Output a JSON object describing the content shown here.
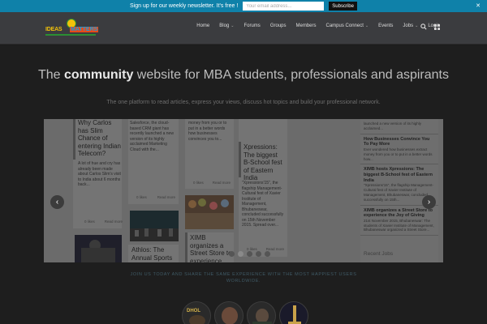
{
  "newsletter": {
    "message": "Sign up for our weekly newsletter. It's free !",
    "email_placeholder": "Your email address...",
    "subscribe_label": "Subscribe",
    "close_glyph": "✕"
  },
  "logo": {
    "word1": "IDEAS",
    "word2": "MATTERS"
  },
  "nav": {
    "items": [
      {
        "label": "Home",
        "dropdown": false
      },
      {
        "label": "Blog",
        "dropdown": true
      },
      {
        "label": "Forums",
        "dropdown": false
      },
      {
        "label": "Groups",
        "dropdown": false
      },
      {
        "label": "Members",
        "dropdown": false
      },
      {
        "label": "Campus Connect",
        "dropdown": true
      },
      {
        "label": "Events",
        "dropdown": false
      },
      {
        "label": "Jobs",
        "dropdown": true
      },
      {
        "label": "Login",
        "dropdown": false
      }
    ],
    "search_icon": "search-icon",
    "menu_icon": "grid-menu-icon"
  },
  "hero": {
    "title_pre": "The ",
    "title_bold": "community",
    "title_post": " website for MBA students, professionals and aspirants",
    "subtitle": "The one platform to read articles, express your views, discuss hot topics and build your professional network."
  },
  "slider": {
    "cards": [
      {
        "title": "Why Carlos has Slim Chance of entering Indian Telecom?",
        "excerpt": "A lot of hue and cry has already been made about Carlos Slim's visit to India about 6 months back...",
        "likes": "0 likes",
        "more": "Read more"
      },
      {
        "title": "",
        "excerpt": "Salesforce, the cloud-based CRM giant has recently launched a new version of its highly acclaimed Marketing Cloud with the...",
        "likes": "0 likes",
        "more": "Read more"
      },
      {
        "title": "",
        "excerpt": "money from you or to put in a better words how businesses convinces you to...",
        "likes": "0 likes",
        "more": "Read more"
      },
      {
        "title": "Xpressions: The biggest B-School fest of Eastern India",
        "excerpt": "\"Xpressions'15\", the flagship Management-Cultural fest of Xavier Institute of Management, Bhubaneswar, concluded successfully on 15th November 2015. Spread over...",
        "likes": "0 likes",
        "more": "Read more"
      },
      {
        "title": "Athlos: The Annual Sports",
        "excerpt": "",
        "likes": "",
        "more": ""
      },
      {
        "title": "XIMB organizes a Street Store to experience the",
        "excerpt": "",
        "likes": "",
        "more": ""
      }
    ],
    "sidebar": {
      "items": [
        {
          "heading": "",
          "desc": "launched a new version of its highly acclaimed..."
        },
        {
          "heading": "How Businesses Convince You To Pay More",
          "desc": "Ever wondered how businesses extract money from you or to put in a better words how..."
        },
        {
          "heading": "XIMB hosts Xpressions: The biggest B-School fest of Eastern India",
          "desc": "\"Xpressions'15\", the flagship Management-Cultural fest of Xavier Institute of Management, Bhubaneswar, concluded successfully on 15th..."
        },
        {
          "heading": "XIMB organizes a Street Store to experience the Joy of Giving",
          "desc": "21st November 2015, Bhubaneswar: The students of Xavier Institute of Management, Bhubaneswar organized a Street Store..."
        }
      ],
      "recent_jobs": "Recent Jobs"
    },
    "prev_glyph": "‹",
    "next_glyph": "›",
    "dots": [
      false,
      true,
      false,
      false,
      false
    ]
  },
  "join": {
    "line1": "JOIN US TODAY AND SHARE THE SAME EXPERIENCE WITH THE MOST HAPPIEST USERS",
    "line2": "WORLDWIDE."
  },
  "avatars": {
    "badge_text": "DHOL"
  }
}
